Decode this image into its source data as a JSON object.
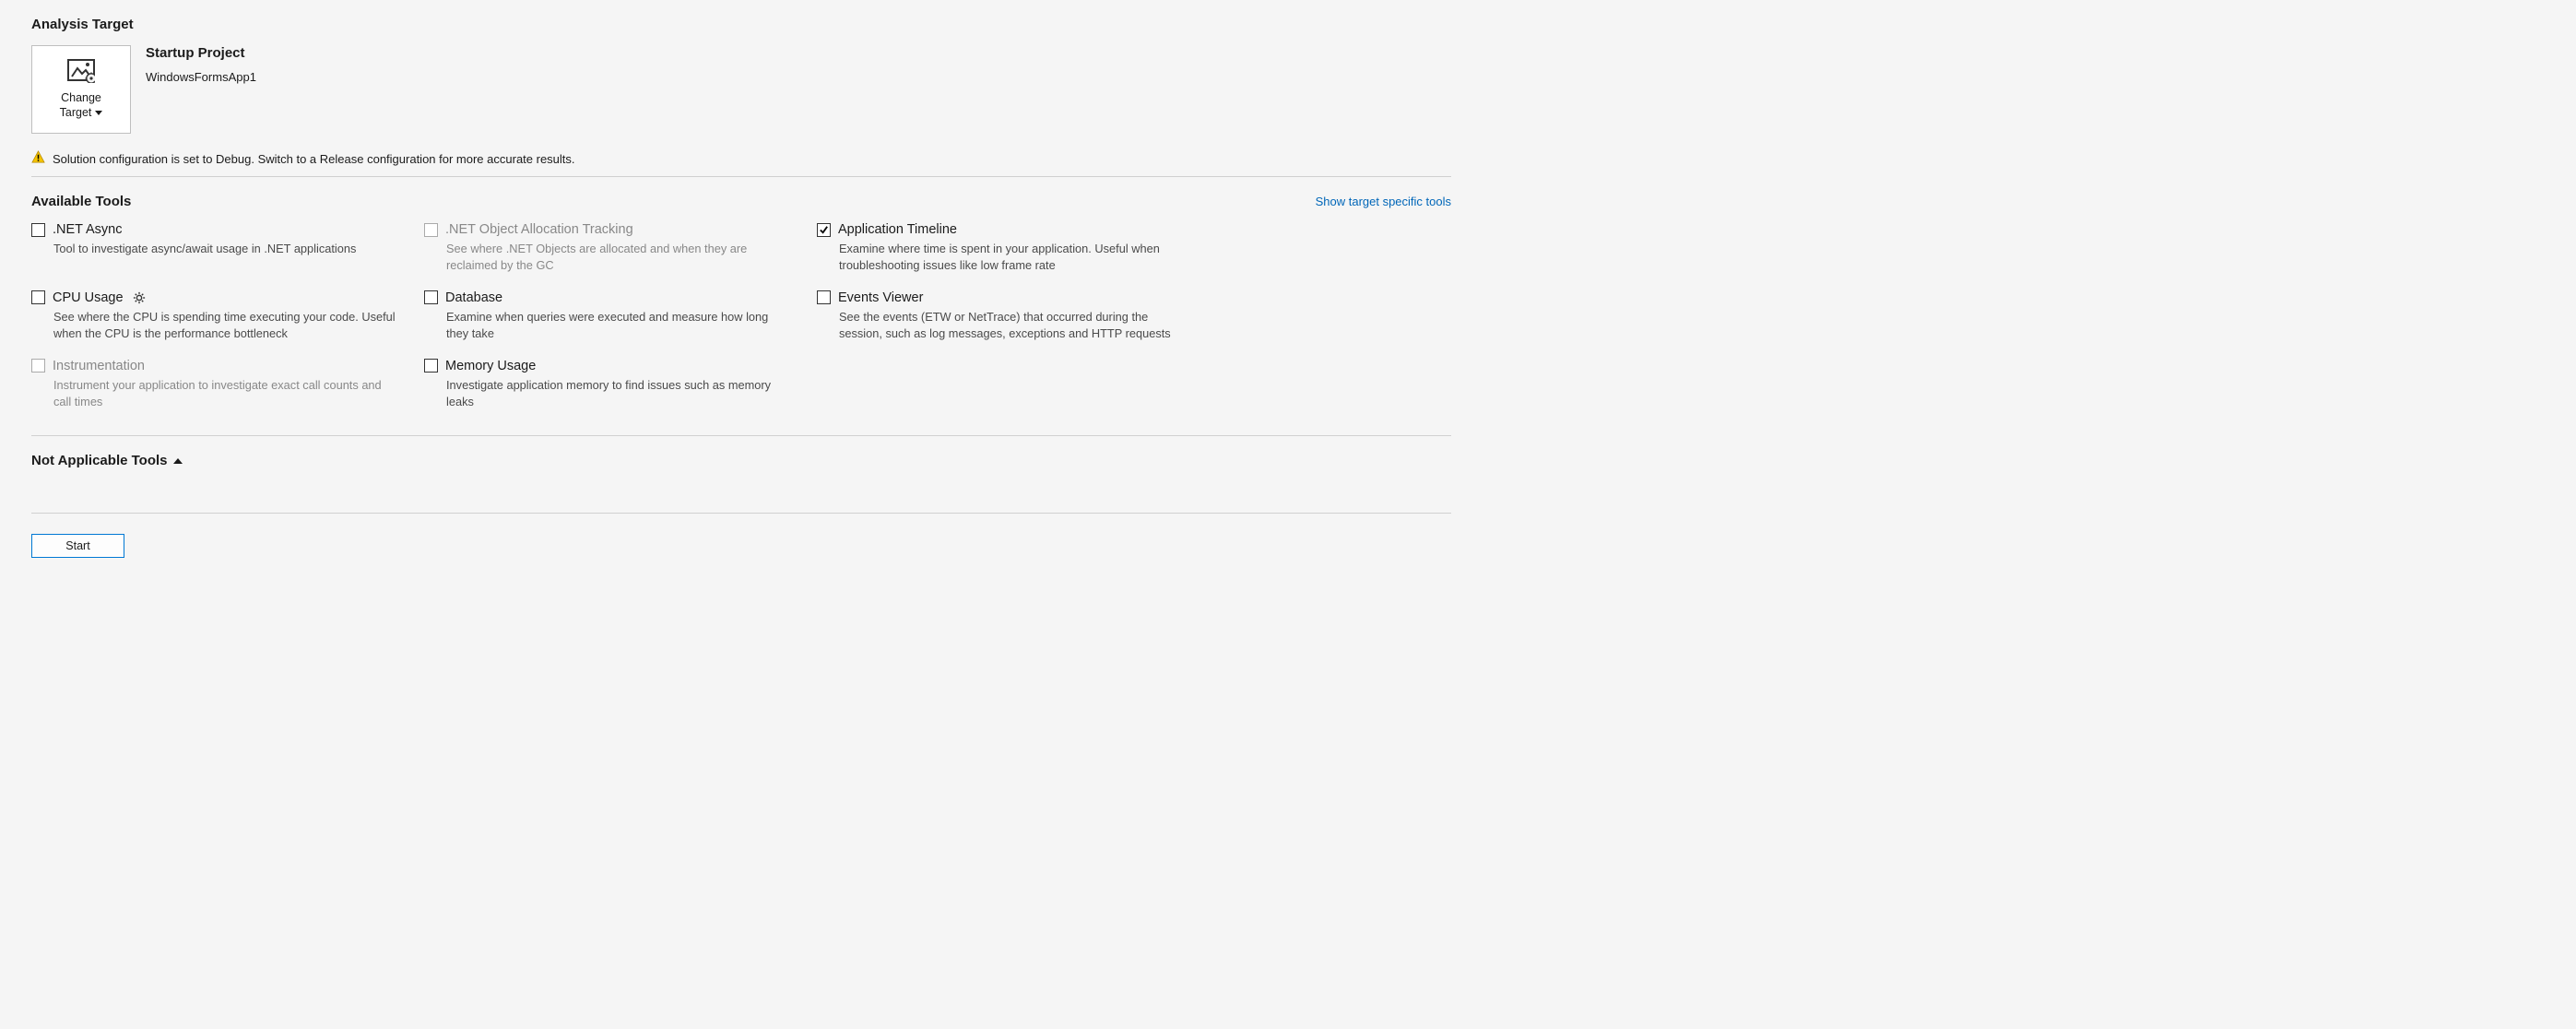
{
  "section_analysis_target": "Analysis Target",
  "change_target_label": "Change\nTarget",
  "target": {
    "title": "Startup Project",
    "name": "WindowsFormsApp1"
  },
  "warning": {
    "text": "Solution configuration is set to Debug. Switch to a Release configuration for more accurate results."
  },
  "section_available_tools": "Available Tools",
  "show_target_specific_link": "Show target specific tools",
  "tools": {
    "net_async": {
      "label": ".NET Async",
      "desc": "Tool to investigate async/await usage in .NET applications",
      "checked": false,
      "enabled": true,
      "has_gear": false
    },
    "net_object_alloc": {
      "label": ".NET Object Allocation Tracking",
      "desc": "See where .NET Objects are allocated and when they are reclaimed by the GC",
      "checked": false,
      "enabled": false,
      "has_gear": false
    },
    "app_timeline": {
      "label": "Application Timeline",
      "desc": "Examine where time is spent in your application. Useful when troubleshooting issues like low frame rate",
      "checked": true,
      "enabled": true,
      "has_gear": false
    },
    "cpu_usage": {
      "label": "CPU Usage",
      "desc": "See where the CPU is spending time executing your code. Useful when the CPU is the performance bottleneck",
      "checked": false,
      "enabled": true,
      "has_gear": true
    },
    "database": {
      "label": "Database",
      "desc": "Examine when queries were executed and measure how long they take",
      "checked": false,
      "enabled": true,
      "has_gear": false
    },
    "events_viewer": {
      "label": "Events Viewer",
      "desc": "See the events (ETW or NetTrace) that occurred during the session, such as log messages, exceptions and HTTP requests",
      "checked": false,
      "enabled": true,
      "has_gear": false
    },
    "instrumentation": {
      "label": "Instrumentation",
      "desc": "Instrument your application to investigate exact call counts and call times",
      "checked": false,
      "enabled": false,
      "has_gear": false
    },
    "memory_usage": {
      "label": "Memory Usage",
      "desc": "Investigate application memory to find issues such as memory leaks",
      "checked": false,
      "enabled": true,
      "has_gear": false
    }
  },
  "section_not_applicable": "Not Applicable Tools",
  "start_button_label": "Start"
}
